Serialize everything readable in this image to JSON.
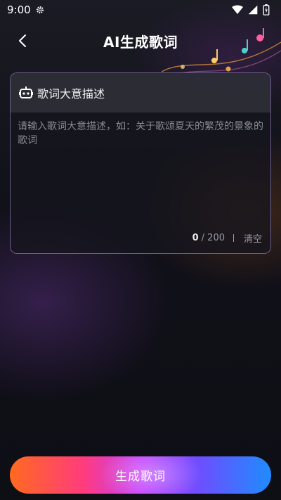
{
  "status_bar": {
    "time": "9:00",
    "icons": [
      "gear-icon",
      "wifi-icon",
      "signal-icon",
      "battery-icon"
    ]
  },
  "header": {
    "title": "AI生成歌词",
    "back_icon": "chevron-left-icon"
  },
  "lyrics_card": {
    "icon": "robot-icon",
    "title": "歌词大意描述",
    "input_value": "",
    "placeholder": "请输入歌词大意描述，如：关于歌颂夏天的繁茂的景象的歌词",
    "count_current": "0",
    "count_max": "/ 200",
    "clear_label": "清空"
  },
  "generate_button": {
    "label": "生成歌词"
  },
  "colors": {
    "accent_border": "#b496e6",
    "button_gradient": [
      "#ff6a1f",
      "#ff3c7c",
      "#c43bff",
      "#6f4dff",
      "#1e8cff"
    ]
  }
}
